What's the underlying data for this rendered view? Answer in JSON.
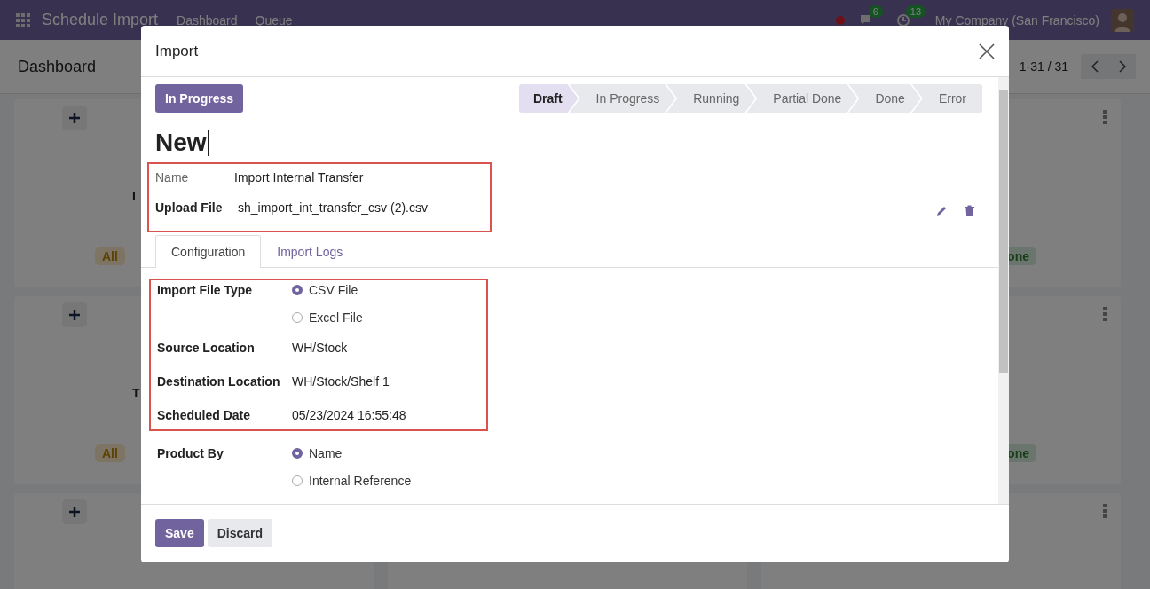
{
  "navbar": {
    "app_title": "Schedule Import",
    "menu": [
      "Dashboard",
      "Queue"
    ],
    "chat_count": "6",
    "activity_count": "13",
    "company": "My Company (San Francisco)"
  },
  "control_panel": {
    "title": "Dashboard",
    "pager": "1-31 / 31"
  },
  "kanban": {
    "rows": [
      {
        "left_title": "I",
        "left_badge": "All",
        "right_badge": "one"
      },
      {
        "left_title": "T",
        "left_badge": "All",
        "right_badge": "one"
      }
    ]
  },
  "dialog": {
    "title": "Import",
    "status_button": "In Progress",
    "stages": [
      {
        "label": "Draft",
        "selected": true
      },
      {
        "label": "In Progress",
        "selected": false
      },
      {
        "label": "Running",
        "selected": false
      },
      {
        "label": "Partial Done",
        "selected": false
      },
      {
        "label": "Done",
        "selected": false
      },
      {
        "label": "Error",
        "selected": false
      }
    ],
    "record_title": "New",
    "header_group": {
      "highlighted": true,
      "fields": [
        {
          "label": "Name",
          "required": false,
          "kind": "text",
          "value": "Import Internal Transfer"
        },
        {
          "label": "Upload File",
          "required": true,
          "kind": "file",
          "value": "sh_import_int_transfer_csv (2).csv"
        }
      ]
    },
    "tabs": [
      {
        "label": "Configuration",
        "selected": true
      },
      {
        "label": "Import Logs",
        "selected": false
      }
    ],
    "config_groups": [
      {
        "highlighted": true,
        "fields": [
          {
            "label": "Import File Type",
            "required": true,
            "kind": "radio",
            "options": [
              {
                "label": "CSV File",
                "selected": true
              },
              {
                "label": "Excel File",
                "selected": false
              }
            ]
          },
          {
            "label": "Source Location",
            "required": true,
            "kind": "text",
            "value": "WH/Stock"
          },
          {
            "label": "Destination Location",
            "required": true,
            "kind": "text",
            "value": "WH/Stock/Shelf 1"
          },
          {
            "label": "Scheduled Date",
            "required": true,
            "kind": "text",
            "value": "05/23/2024 16:55:48"
          }
        ]
      },
      {
        "highlighted": false,
        "fields": [
          {
            "label": "Product By",
            "required": true,
            "kind": "radio",
            "options": [
              {
                "label": "Name",
                "selected": true
              },
              {
                "label": "Internal Reference",
                "selected": false
              }
            ]
          }
        ]
      }
    ],
    "buttons": [
      {
        "label": "Save",
        "kind": "primary"
      },
      {
        "label": "Discard",
        "kind": "secondary"
      }
    ]
  }
}
